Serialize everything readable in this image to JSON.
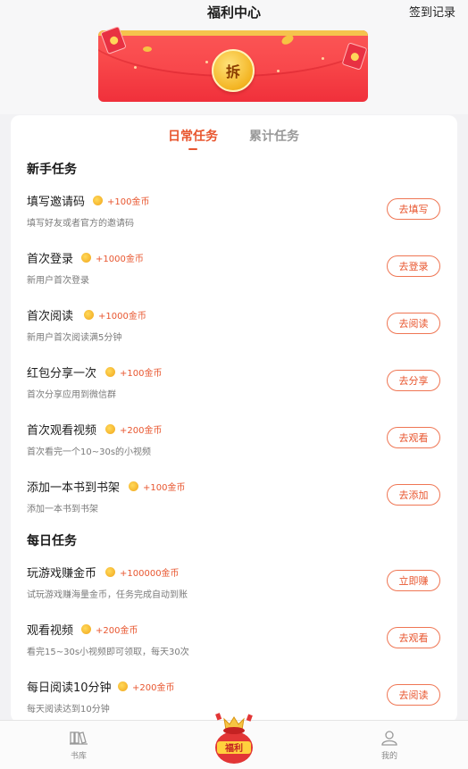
{
  "header": {
    "title": "福利中心",
    "signin_label": "签到记录"
  },
  "banner": {
    "seal_text": "拆"
  },
  "tabs": [
    {
      "label": "日常任务",
      "active": true
    },
    {
      "label": "累计任务",
      "active": false
    }
  ],
  "sections": {
    "newbie": {
      "title": "新手任务",
      "tasks": [
        {
          "name": "填写邀请码",
          "reward": "+100金币",
          "desc": "填写好友或者官方的邀请码",
          "button": "去填写"
        },
        {
          "name": "首次登录",
          "reward": "+1000金币",
          "desc": "新用户首次登录",
          "button": "去登录"
        },
        {
          "name": "首次阅读",
          "reward": "+1000金币",
          "desc": "新用户首次阅读满5分钟",
          "button": "去阅读"
        },
        {
          "name": "红包分享一次",
          "reward": "+100金币",
          "desc": "首次分享应用到微信群",
          "button": "去分享"
        },
        {
          "name": "首次观看视频",
          "reward": "+200金币",
          "desc": "首次看完一个10~30s的小视频",
          "button": "去观看"
        },
        {
          "name": "添加一本书到书架",
          "reward": "+100金币",
          "desc": "添加一本书到书架",
          "button": "去添加"
        }
      ]
    },
    "daily": {
      "title": "每日任务",
      "tasks": [
        {
          "name": "玩游戏赚金币",
          "reward": "+100000金币",
          "desc": "试玩游戏赚海量金币，任务完成自动到账",
          "button": "立即赚"
        },
        {
          "name": "观看视频",
          "reward": "+200金币",
          "desc": "看完15~30s小视频即可领取，每天30次",
          "button": "去观看"
        },
        {
          "name": "每日阅读10分钟",
          "reward": "+200金币",
          "desc": "每天阅读达到10分钟",
          "button": "去阅读"
        }
      ]
    }
  },
  "bottom_nav": {
    "library_label": "书库",
    "center_label": "福利",
    "mine_label": "我的"
  },
  "colors": {
    "accent": "#e8562f",
    "envelope_red": "#f0303b",
    "gold": "#f3b422"
  }
}
